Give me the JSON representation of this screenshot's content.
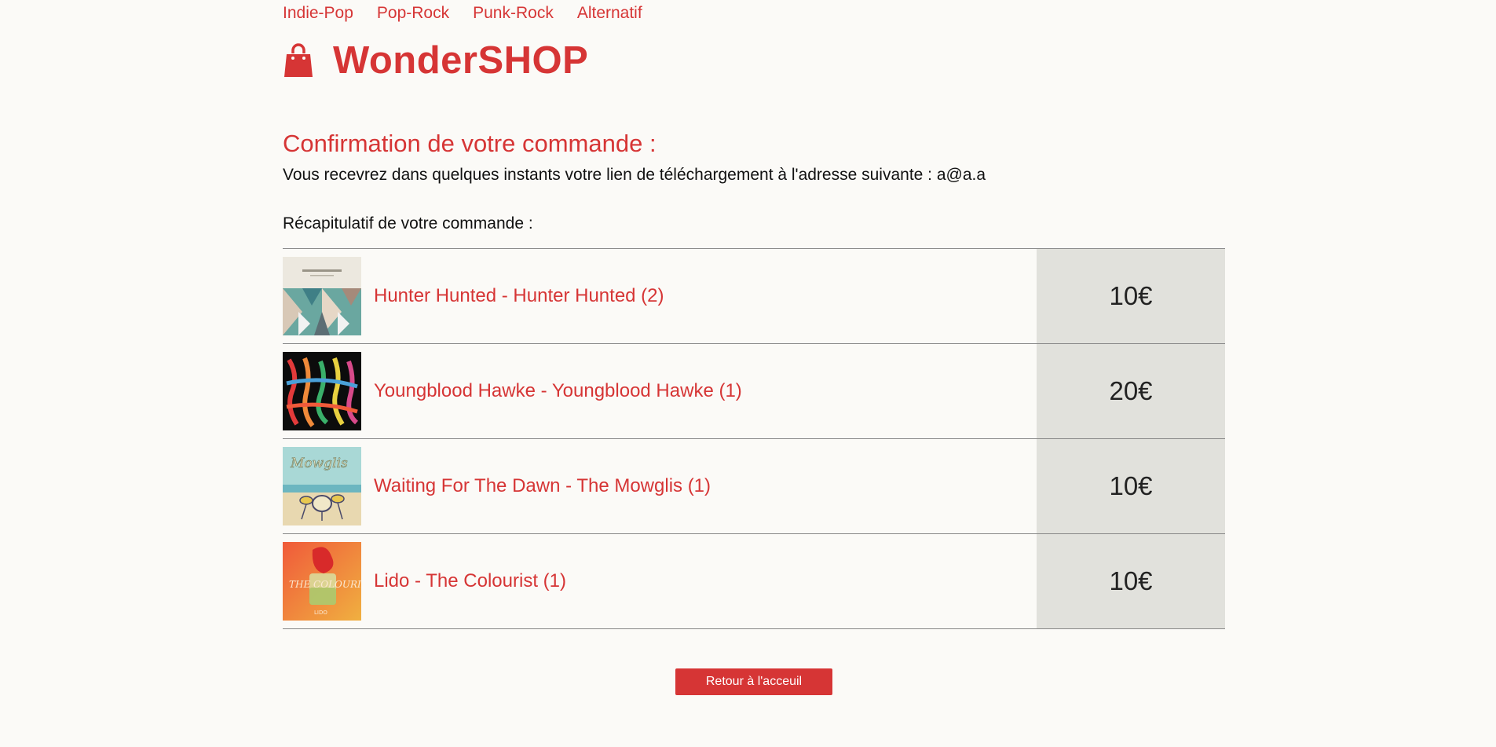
{
  "nav": {
    "items": [
      {
        "label": "Indie-Pop"
      },
      {
        "label": "Pop-Rock"
      },
      {
        "label": "Punk-Rock"
      },
      {
        "label": "Alternatif"
      }
    ]
  },
  "header": {
    "brand": "WonderSHOP",
    "logo_icon": "shopping-bag-icon"
  },
  "confirmation": {
    "title": "Confirmation de votre commande :",
    "text": "Vous recevrez dans quelques instants votre lien de téléchargement à l'adresse suivante : a@a.a"
  },
  "recap": {
    "title": "Récapitulatif de votre commande :",
    "items": [
      {
        "name": "Hunter Hunted - Hunter Hunted (2)",
        "price": "10€",
        "cover_icon": "album-cover-hunter-hunted"
      },
      {
        "name": "Youngblood Hawke - Youngblood Hawke (1)",
        "price": "20€",
        "cover_icon": "album-cover-youngblood-hawke"
      },
      {
        "name": "Waiting For The Dawn - The Mowglis (1)",
        "price": "10€",
        "cover_icon": "album-cover-the-mowglis"
      },
      {
        "name": "Lido - The Colourist (1)",
        "price": "10€",
        "cover_icon": "album-cover-the-colourist"
      }
    ]
  },
  "actions": {
    "back_label": "Retour à l'acceuil"
  },
  "colors": {
    "accent": "#d63535",
    "background": "#fbfaf7",
    "price_cell": "#e1e1dc"
  }
}
